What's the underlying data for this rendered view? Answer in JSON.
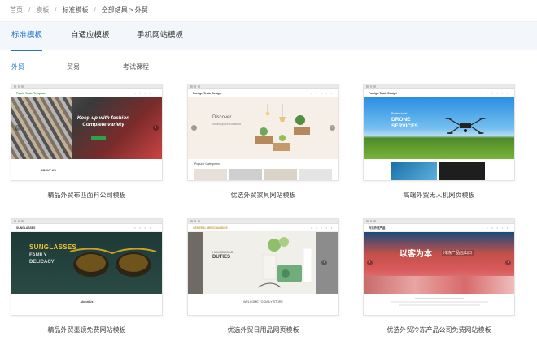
{
  "breadcrumb": {
    "items": [
      "首页",
      "模板",
      "标准模板",
      "全部结果 > 外贸"
    ],
    "separator": "/"
  },
  "tabs": [
    {
      "label": "标准模板",
      "active": true
    },
    {
      "label": "自适应模板",
      "active": false
    },
    {
      "label": "手机网站模板",
      "active": false
    }
  ],
  "subtabs": [
    {
      "label": "外贸",
      "active": true
    },
    {
      "label": "贸易",
      "active": false
    },
    {
      "label": "考试课程",
      "active": false
    }
  ],
  "templates": [
    {
      "caption": "精品外贸布匹面料公司模板",
      "nav_logo": "Fabric Trade Template",
      "hero_lines": [
        "Keep up with fashion",
        "Complete variety"
      ],
      "below_text": "ABOUT US"
    },
    {
      "caption": "优选外贸家具网站模板",
      "nav_logo": "Foreign Trade Design",
      "hero_lines": [
        "Discover",
        "Small Space Solutions"
      ],
      "below_text": "Popular Categories"
    },
    {
      "caption": "高端外贸无人机网页模板",
      "nav_logo": "Foreign Trade Design",
      "hero_lines": [
        "Professional",
        "DRONE",
        "SERVICES"
      ],
      "below_text": ""
    },
    {
      "caption": "精品外贸墨镜免费网站模板",
      "nav_logo": "SUNGLASSES",
      "hero_lines": [
        "SUNGLASSES",
        "FAMILY",
        "DELICACY"
      ],
      "below_text": "About Us"
    },
    {
      "caption": "优选外贸日用品网页模板",
      "nav_logo": "GENERAL MERCHANDISE",
      "hero_lines": [
        "HOUSEHOLD",
        "DUTIES"
      ],
      "below_text": "WELCOME TO DAILY STORE"
    },
    {
      "caption": "优选外贸冷冻产品公司免费网站模板",
      "nav_logo": "冷冻外贸产品",
      "hero_lines": [
        "以客为本",
        "冷冻产品远出口"
      ],
      "below_text": ""
    }
  ],
  "colors": {
    "accent": "#1f74d4",
    "tabbar_bg": "#f3f6fa"
  }
}
